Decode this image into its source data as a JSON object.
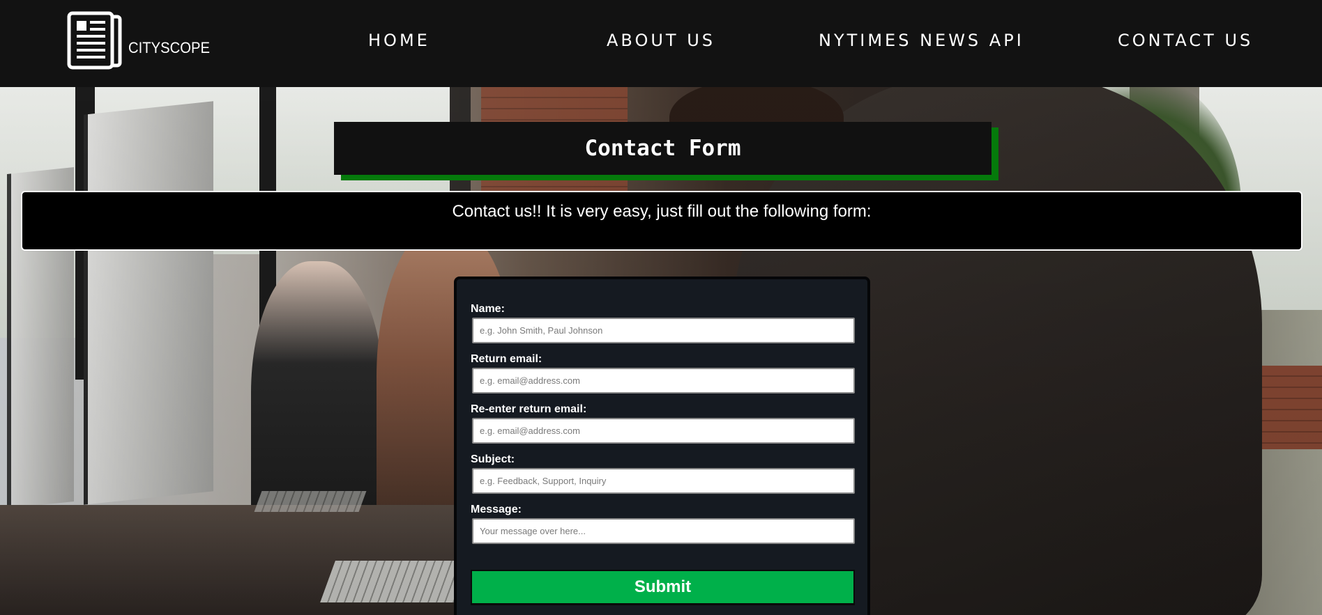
{
  "header": {
    "logo_text": "CITYSCOPE",
    "nav": {
      "home": "HOME",
      "about": "ABOUT US",
      "news_api": "NYTIMES NEWS API",
      "contact": "CONTACT US"
    }
  },
  "page": {
    "title": "Contact Form",
    "intro": "Contact us!! It is very easy, just fill out the following form:"
  },
  "form": {
    "name": {
      "label": "Name:",
      "placeholder": "e.g. John Smith, Paul Johnson"
    },
    "email": {
      "label": "Return email:",
      "placeholder": "e.g. email@address.com"
    },
    "email_confirm": {
      "label": "Re-enter return email:",
      "placeholder": "e.g. email@address.com"
    },
    "subject": {
      "label": "Subject:",
      "placeholder": "e.g. Feedback, Support, Inquiry"
    },
    "message": {
      "label": "Message:",
      "placeholder": "Your message over here..."
    },
    "submit_label": "Submit"
  },
  "colors": {
    "header_bg": "#121212",
    "title_shadow": "#057a0b",
    "submit_bg": "#00b04a",
    "form_bg": "#151a21"
  },
  "icons": {
    "logo": "newspaper-icon"
  }
}
